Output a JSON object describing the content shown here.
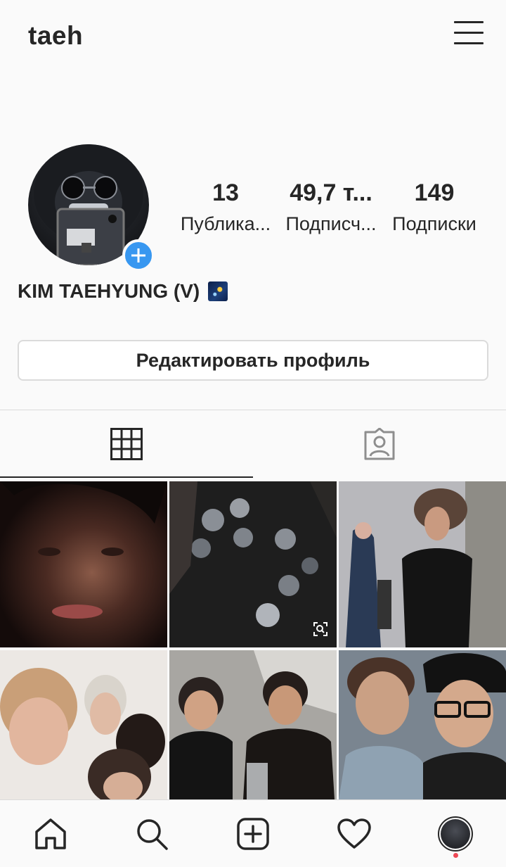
{
  "header": {
    "username": "taeh"
  },
  "profile": {
    "stats": [
      {
        "count": "13",
        "label": "Публика..."
      },
      {
        "count": "49,7 т...",
        "label": "Подписч..."
      },
      {
        "count": "149",
        "label": "Подписки"
      }
    ],
    "full_name": "KIM TAEHYUNG (V)",
    "name_emoji": "night-sky-emoji",
    "edit_button_label": "Редактировать профиль"
  },
  "tabs": [
    {
      "icon": "grid-icon",
      "active": true
    },
    {
      "icon": "tagged-person-icon",
      "active": false
    }
  ],
  "posts": [
    {
      "description": "close-up-face-dark",
      "has_overlay_icon": false
    },
    {
      "description": "hands-holding-cans",
      "has_overlay_icon": true,
      "overlay_icon": "zoom-icon"
    },
    {
      "description": "person-in-gym",
      "has_overlay_icon": false
    },
    {
      "description": "group-selfie",
      "has_overlay_icon": false
    },
    {
      "description": "friends-at-party",
      "has_overlay_icon": false
    },
    {
      "description": "two-friends-posing",
      "has_overlay_icon": false
    }
  ],
  "bottom_nav": [
    {
      "icon": "home-icon"
    },
    {
      "icon": "search-icon"
    },
    {
      "icon": "new-post-icon"
    },
    {
      "icon": "heart-icon"
    },
    {
      "icon": "profile-avatar-icon",
      "has_notification": true
    }
  ],
  "colors": {
    "accent": "#3897f0",
    "text": "#262626",
    "border": "#dbdbdb",
    "background": "#fafafa",
    "notification": "#ed4956"
  }
}
